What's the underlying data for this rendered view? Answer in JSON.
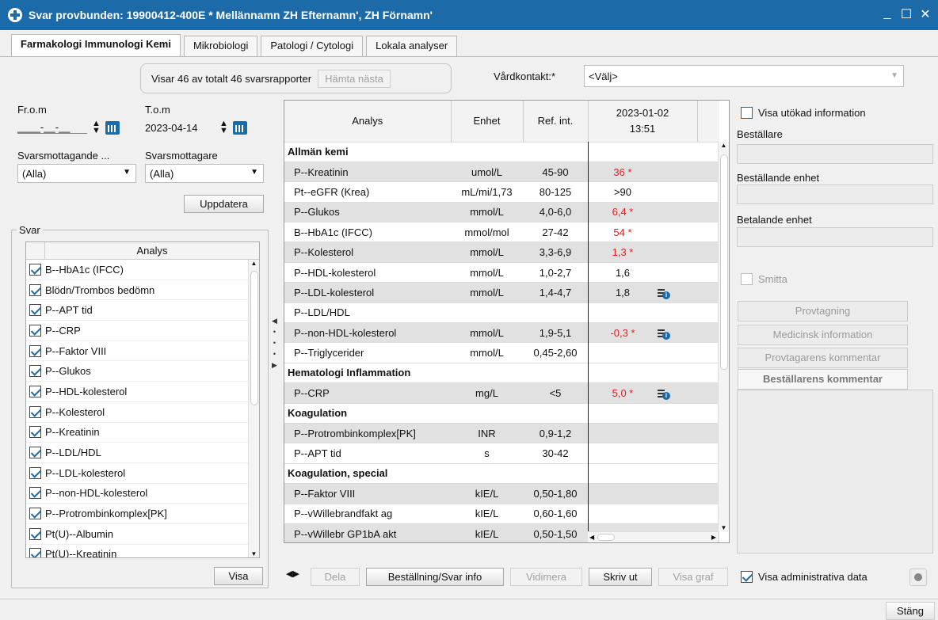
{
  "window": {
    "title": "Svar provbunden: 19900412-400E * Mellännamn ZH Efternamn', ZH Förnamn'",
    "min": "_",
    "max": "☐",
    "close": "✕"
  },
  "tabs": [
    "Farmakologi Immunologi Kemi",
    "Mikrobiologi",
    "Patologi / Cytologi",
    "Lokala analyser"
  ],
  "reports": {
    "status": "Visar 46 av totalt 46 svarsrapporter",
    "fetch_next": "Hämta nästa"
  },
  "vardkontakt": {
    "label": "Vårdkontakt:*",
    "value": "<Välj>"
  },
  "filters": {
    "from_label": "Fr.o.m",
    "from_value": "____-__-__",
    "to_label": "T.o.m",
    "to_value": "2023-04-14",
    "recipient_unit_label": "Svarsmottagande ...",
    "recipient_unit_value": "(Alla)",
    "recipient_label": "Svarsmottagare",
    "recipient_value": "(Alla)",
    "update": "Uppdatera"
  },
  "svar": {
    "legend": "Svar",
    "column": "Analys",
    "items": [
      "B--HbA1c (IFCC)",
      "Blödn/Trombos bedömn",
      "P--APT tid",
      "P--CRP",
      "P--Faktor VIII",
      "P--Glukos",
      "P--HDL-kolesterol",
      "P--Kolesterol",
      "P--Kreatinin",
      "P--LDL/HDL",
      "P--LDL-kolesterol",
      "P--non-HDL-kolesterol",
      "P--Protrombinkomplex[PK]",
      "Pt(U)--Albumin",
      "Pt(U)--Kreatinin"
    ],
    "show": "Visa"
  },
  "results": {
    "headers": {
      "analys": "Analys",
      "enhet": "Enhet",
      "ref": "Ref. int.",
      "date": "2023-01-02",
      "time": "13:51"
    },
    "rows": [
      {
        "type": "group",
        "name": "Allmän kemi"
      },
      {
        "name": "P--Kreatinin",
        "unit": "umol/L",
        "ref": "45-90",
        "value": "36 *",
        "flag": true,
        "info": false
      },
      {
        "name": "Pt--eGFR (Krea)",
        "unit": "mL/mi/1,73",
        "ref": "80-125",
        "value": ">90",
        "flag": false,
        "info": false
      },
      {
        "name": "P--Glukos",
        "unit": "mmol/L",
        "ref": "4,0-6,0",
        "value": "6,4 *",
        "flag": true,
        "info": false
      },
      {
        "name": "B--HbA1c (IFCC)",
        "unit": "mmol/mol",
        "ref": "27-42",
        "value": "54 *",
        "flag": true,
        "info": false
      },
      {
        "name": "P--Kolesterol",
        "unit": "mmol/L",
        "ref": "3,3-6,9",
        "value": "1,3 *",
        "flag": true,
        "info": false
      },
      {
        "name": "P--HDL-kolesterol",
        "unit": "mmol/L",
        "ref": "1,0-2,7",
        "value": "1,6",
        "flag": false,
        "info": false
      },
      {
        "name": "P--LDL-kolesterol",
        "unit": "mmol/L",
        "ref": "1,4-4,7",
        "value": "1,8",
        "flag": false,
        "info": true
      },
      {
        "name": "P--LDL/HDL",
        "unit": "",
        "ref": "",
        "value": "",
        "flag": false,
        "info": false
      },
      {
        "name": "P--non-HDL-kolesterol",
        "unit": "mmol/L",
        "ref": "1,9-5,1",
        "value": "-0,3 *",
        "flag": true,
        "info": true
      },
      {
        "name": "P--Triglycerider",
        "unit": "mmol/L",
        "ref": "0,45-2,60",
        "value": "",
        "flag": false,
        "info": false
      },
      {
        "type": "group",
        "name": "Hematologi Inflammation"
      },
      {
        "name": "P--CRP",
        "unit": "mg/L",
        "ref": "<5",
        "value": "5,0 *",
        "flag": true,
        "info": true
      },
      {
        "type": "group",
        "name": "Koagulation"
      },
      {
        "name": "P--Protrombinkomplex[PK]",
        "unit": "INR",
        "ref": "0,9-1,2",
        "value": "",
        "flag": false,
        "info": false
      },
      {
        "name": "P--APT tid",
        "unit": "s",
        "ref": "30-42",
        "value": "",
        "flag": false,
        "info": false
      },
      {
        "type": "group",
        "name": "Koagulation, special"
      },
      {
        "name": "P--Faktor VIII",
        "unit": "kIE/L",
        "ref": "0,50-1,80",
        "value": "",
        "flag": false,
        "info": false
      },
      {
        "name": "P--vWillebrandfakt ag",
        "unit": "kIE/L",
        "ref": "0,60-1,60",
        "value": "",
        "flag": false,
        "info": false
      },
      {
        "name": "P--vWillebr GP1bA akt",
        "unit": "kIE/L",
        "ref": "0,50-1,50",
        "value": "",
        "flag": false,
        "info": false
      }
    ]
  },
  "right": {
    "show_extended": "Visa utökad information",
    "bestallare": "Beställare",
    "bestallande_enhet": "Beställande enhet",
    "betalande_enhet": "Betalande enhet",
    "smitta": "Smitta",
    "tabs": [
      "Provtagning",
      "Medicinsk information",
      "Provtagarens kommentar",
      "Beställarens kommentar"
    ]
  },
  "toolbar": {
    "dela": "Dela",
    "bestallning": "Beställning/Svar info",
    "vidimera": "Vidimera",
    "skriv_ut": "Skriv ut",
    "visa_graf": "Visa graf",
    "admin": "Visa administrativa data",
    "close": "Stäng"
  }
}
